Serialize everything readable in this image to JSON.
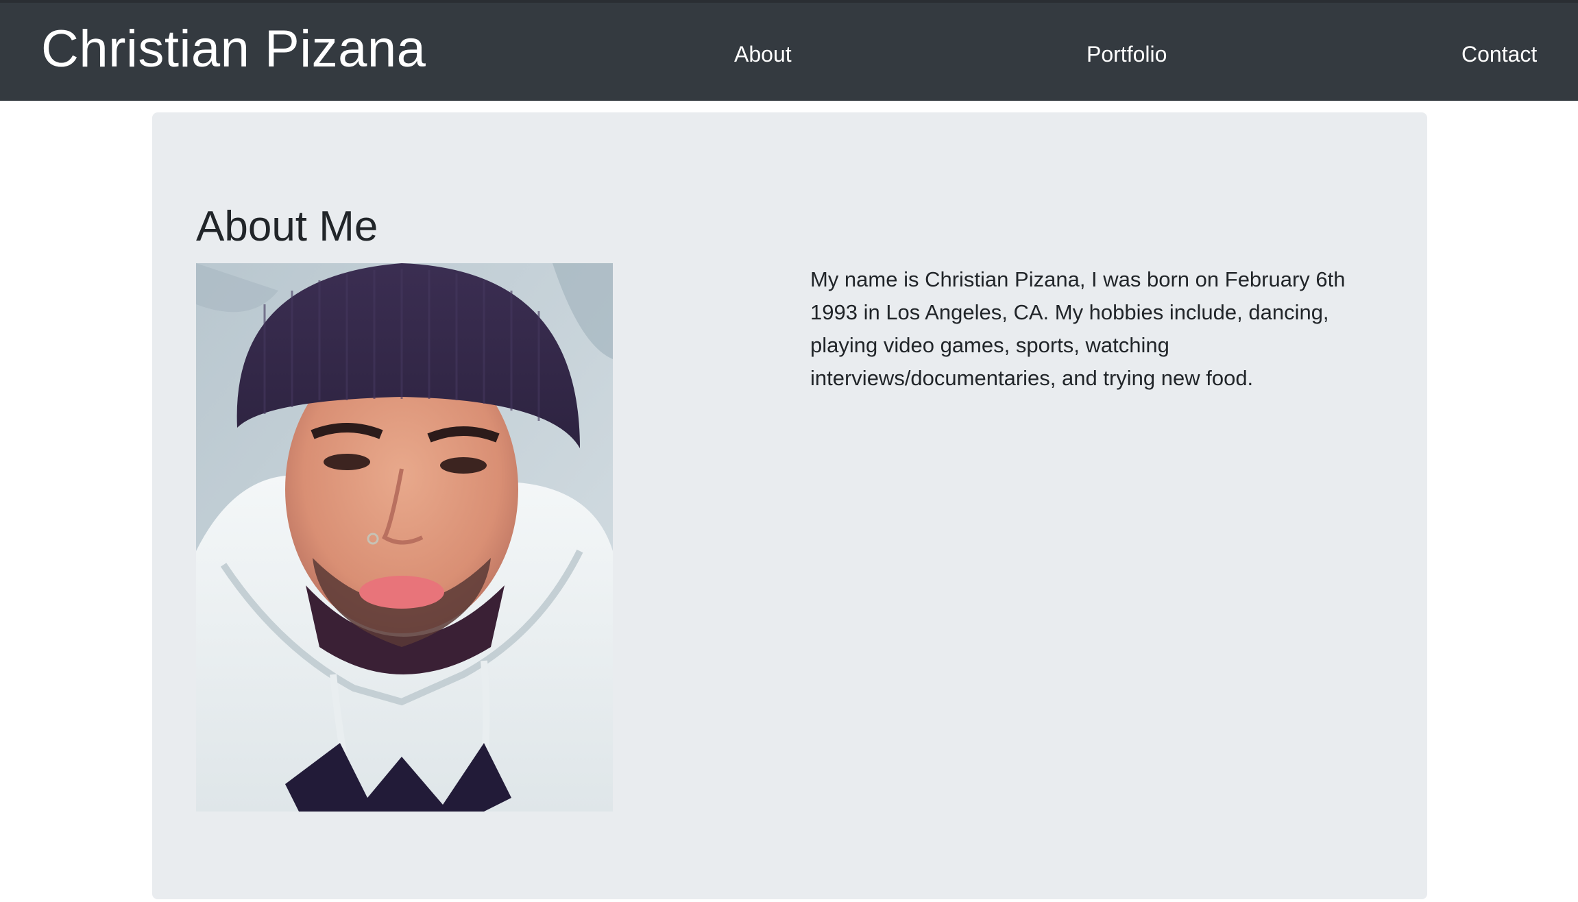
{
  "header": {
    "brand": "Christian Pizana",
    "nav": {
      "about": "About",
      "portfolio": "Portfolio",
      "contact": "Contact"
    }
  },
  "about": {
    "title": "About Me",
    "bio": "My name is Christian Pizana, I was born on February 6th 1993 in Los Angeles, CA. My hobbies include, dancing, playing video games, sports, watching interviews/documentaries, and trying new food."
  },
  "colors": {
    "navbar": "#343a40",
    "jumbotron": "#e9ecef",
    "text": "#212529"
  }
}
